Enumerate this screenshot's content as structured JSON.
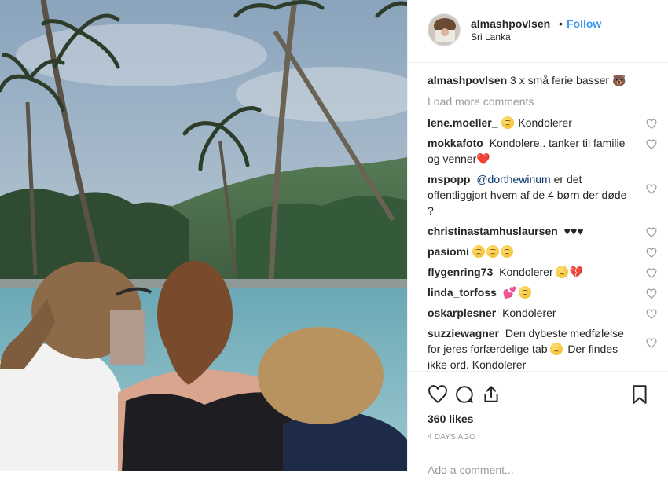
{
  "post": {
    "username": "almashpovlsen",
    "separator": "•",
    "follow_label": "Follow",
    "location": "Sri Lanka",
    "caption_user": "almashpovlsen",
    "caption_text": "3 x små ferie basser 🐻",
    "load_more_label": "Load more comments"
  },
  "comments": [
    {
      "user": "lene.moeller_",
      "pre_emoji": "sad",
      "text": "Kondolerer",
      "mention": false
    },
    {
      "user": "mokkafoto",
      "text": "Kondolere.. tanker til familie og venner❤️",
      "mention": false
    },
    {
      "user": "mspopp",
      "mention_text": "@dorthewinum",
      "text": "er det offentliggjort hvem af de 4 børn der døde ?"
    },
    {
      "user": "christinastamhuslaursen",
      "text": "♥♥♥"
    },
    {
      "user": "pasiomi",
      "emoji_count": 3,
      "text": ""
    },
    {
      "user": "flygenring73",
      "text": "Kondolerer",
      "post_emoji": "sad 💔"
    },
    {
      "user": "linda_torfoss",
      "text": "💕",
      "post_emoji": "sad"
    },
    {
      "user": "oskarplesner",
      "text": "Kondolerer"
    },
    {
      "user": "suzziewagner",
      "text": "Den dybeste medfølelse for jeres forfærdelige tab",
      "text2": "Der findes ikke ord. Kondolerer"
    }
  ],
  "actions": {
    "likes": "360 likes",
    "time_ago": "4 DAYS AGO",
    "add_comment_placeholder": "Add a comment..."
  },
  "colors": {
    "link": "#3897f0",
    "muted": "#999999",
    "text": "#262626"
  }
}
